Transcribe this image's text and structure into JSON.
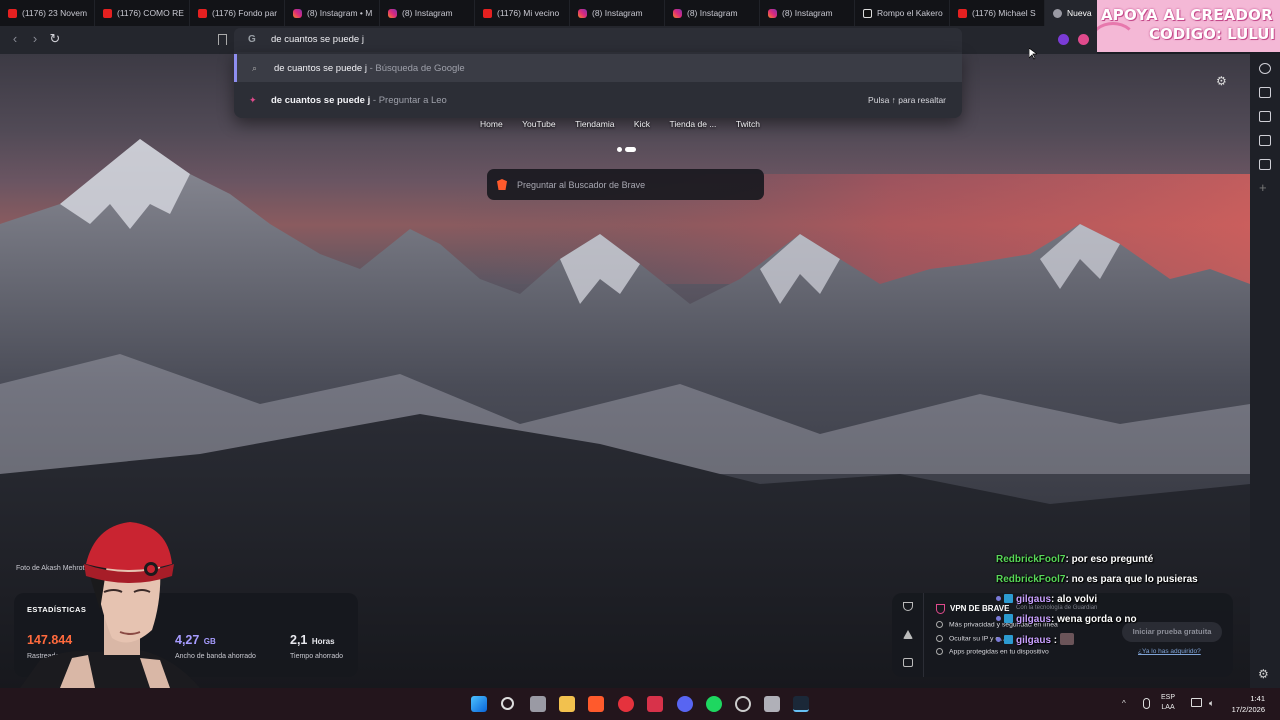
{
  "tabs": [
    {
      "label": "(1176) 23 Novem",
      "favicon": "youtube-icon"
    },
    {
      "label": "(1176) COMO RE",
      "favicon": "youtube-icon"
    },
    {
      "label": "(1176) Fondo par",
      "favicon": "youtube-icon"
    },
    {
      "label": "(8) Instagram • M",
      "favicon": "instagram-icon"
    },
    {
      "label": "(8) Instagram",
      "favicon": "instagram-icon"
    },
    {
      "label": "(1176) Mi vecino",
      "favicon": "youtube-icon"
    },
    {
      "label": "(8) Instagram",
      "favicon": "instagram-icon"
    },
    {
      "label": "(8) Instagram",
      "favicon": "instagram-icon"
    },
    {
      "label": "(8) Instagram",
      "favicon": "instagram-icon"
    },
    {
      "label": "Rompo el Kakero",
      "favicon": "tiktok-icon"
    },
    {
      "label": "(1176) Michael S",
      "favicon": "youtube-icon"
    },
    {
      "label": "Nueva",
      "favicon": "brave-icon",
      "active": true
    }
  ],
  "banner": {
    "line1": "APOYA AL CREADOR",
    "line2": "CODIGO: LULUI"
  },
  "omnibox": {
    "value": "de cuantos se puede j"
  },
  "suggestions": [
    {
      "query": "de cuantos se puede j",
      "separator": " - ",
      "source": "Búsqueda de Google",
      "icon": "search-icon"
    },
    {
      "query": "de cuantos se puede j",
      "separator": " - ",
      "source": "Preguntar a Leo",
      "icon": "leo-icon",
      "hint": "Pulsa ↑ para resaltar"
    }
  ],
  "top_sites": [
    "Home",
    "YouTube",
    "Tiendamia",
    "Kick",
    "Tienda de ...",
    "Twitch"
  ],
  "brave_search": {
    "placeholder": "Preguntar al Buscador de Brave"
  },
  "photo_credit": "Foto de Akash Mehrot",
  "stats": {
    "title": "ESTADÍSTICAS",
    "items": [
      {
        "value": "147.844",
        "unit": "",
        "label": "Rastreado",
        "color": "#ff6a3d"
      },
      {
        "value": "4,27",
        "unit": "GB",
        "label": "Ancho de banda ahorrado",
        "color": "#a79cff"
      },
      {
        "value": "2,1",
        "unit": "Horas",
        "label": "Tiempo ahorrado",
        "color": "#ffffff"
      }
    ]
  },
  "vpn": {
    "title": "VPN DE BRAVE",
    "subtitle": "Con la tecnología de Guardian",
    "features": [
      "Más privacidad y seguridad en línea",
      "Ocultar su IP y c...",
      "Apps protegidas en tu dispositivo"
    ],
    "trial_button": "Iniciar prueba gratuita",
    "link": "¿Ya lo has adquirido?"
  },
  "chat": [
    {
      "user": "RedbrickFool7",
      "text": ": por eso pregunté",
      "color": "green"
    },
    {
      "user": "RedbrickFool7",
      "text": ": no es para que lo pusieras",
      "color": "green"
    },
    {
      "user": "gilgaus",
      "text": ": alo volvi",
      "color": "purple"
    },
    {
      "user": "gilgaus",
      "text": ": wena gorda o no",
      "color": "purple"
    },
    {
      "user": "gilgaus",
      "text": " :",
      "color": "purple",
      "emote": true
    }
  ],
  "tray": {
    "lang1": "ESP",
    "lang2": "LAA",
    "time": "1:41",
    "date": "17/2/2026"
  },
  "colors": {
    "accent": "#8e8ef0",
    "brave_orange": "#ff5a2c",
    "vpn_pink": "#e04a8c"
  }
}
